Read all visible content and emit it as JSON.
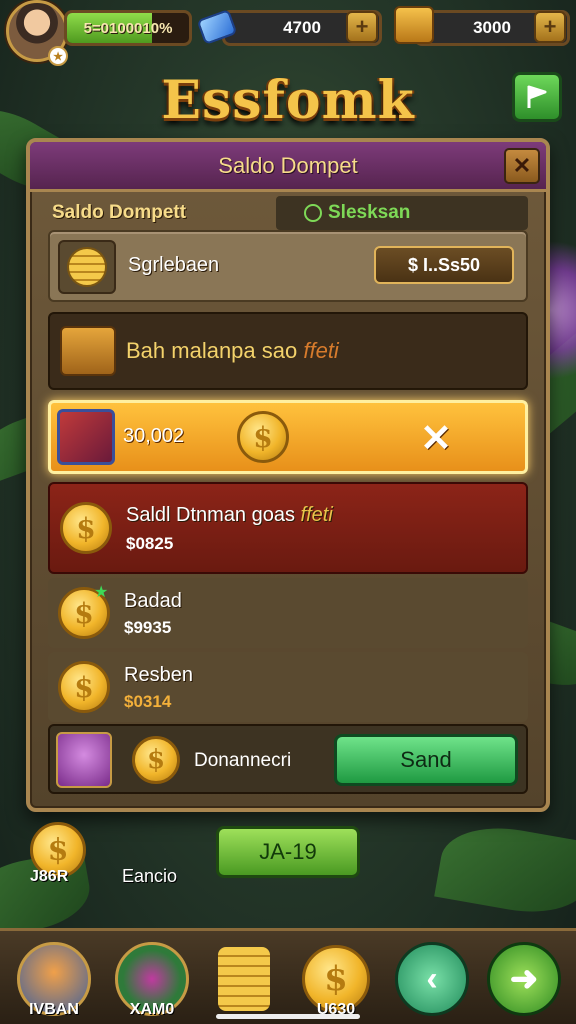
{
  "game": {
    "title": "Essfomk"
  },
  "hud": {
    "xp_text": "5=0100010%",
    "xp_fraction": 0.7,
    "gems": "4700",
    "gold": "3000"
  },
  "panel": {
    "title": "Saldo Dompet",
    "tabs": [
      {
        "label": "Saldo Dompett"
      },
      {
        "label": "Slesksan"
      }
    ],
    "balance": {
      "label": "Sgrlebaen",
      "value": "$ I..Ss50"
    },
    "info": {
      "text": "Bah malanpa sao",
      "highlight": "ffeti"
    },
    "active": {
      "value": "30,002"
    },
    "transactions": [
      {
        "name": "Saldl Dtnman goas",
        "highlight": "ffeti",
        "amount": "$0825"
      },
      {
        "name": "Badad",
        "amount": "$9935"
      },
      {
        "name": "Resben",
        "amount": "$0314"
      }
    ],
    "send": {
      "label": "Donannecri",
      "button": "Sand"
    }
  },
  "below": {
    "coin_label": "J86R",
    "stat_label": "Eancio",
    "range_button": "JA-19"
  },
  "nav": [
    {
      "label": "IVBAN",
      "icon": "avatar-fox"
    },
    {
      "label": "XAM0",
      "icon": "spellbook-icon"
    },
    {
      "label": "",
      "icon": "coin-stack-icon"
    },
    {
      "label": "U630",
      "icon": "dollar-coin-icon"
    },
    {
      "label": "",
      "icon": "back-arrow-icon"
    },
    {
      "label": "",
      "icon": "forward-arrow-icon"
    }
  ],
  "icons": {
    "coin": "$",
    "close": "✕",
    "plus": "+"
  },
  "colors": {
    "accent_gold": "#f4c44a",
    "header_purple": "#7d3b7a",
    "send_green": "#1f9a42"
  }
}
